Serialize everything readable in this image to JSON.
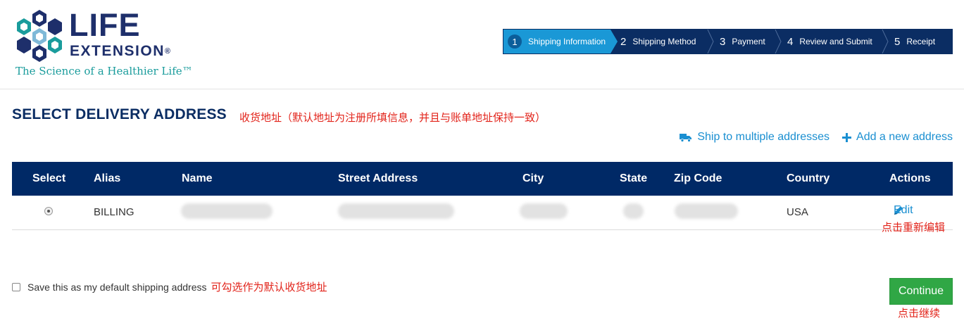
{
  "logo": {
    "line1": "LIFE",
    "line2": "EXTENSION",
    "registered": "®",
    "tagline": "The Science of a Healthier Life™"
  },
  "steps": [
    {
      "num": "1",
      "label": "Shipping Information",
      "active": true
    },
    {
      "num": "2",
      "label": "Shipping Method",
      "active": false
    },
    {
      "num": "3",
      "label": "Payment",
      "active": false
    },
    {
      "num": "4",
      "label": "Review and Submit",
      "active": false
    },
    {
      "num": "5",
      "label": "Receipt",
      "active": false
    }
  ],
  "page": {
    "title": "SELECT DELIVERY ADDRESS",
    "title_note": "收货地址（默认地址为注册所填信息，并且与账单地址保持一致）"
  },
  "links": {
    "ship_multiple": "Ship to multiple addresses",
    "add_new": "Add a new address",
    "ship_multiple_icon": "truck-icon",
    "add_new_icon": "plus-icon"
  },
  "table": {
    "headers": [
      "Select",
      "Alias",
      "Name",
      "Street Address",
      "City",
      "State",
      "Zip Code",
      "Country",
      "Actions"
    ],
    "rows": [
      {
        "alias": "BILLING",
        "country": "USA",
        "edit": "Edit",
        "edit_icon": "pencil-icon",
        "selected": true
      }
    ],
    "edit_note": "点击重新编辑"
  },
  "footer": {
    "save_label": "Save this as my default shipping address",
    "save_note": "可勾选作为默认收货地址",
    "continue_label": "Continue",
    "continue_note": "点击继续"
  },
  "colors": {
    "navy": "#002966",
    "step_active": "#1a98d6",
    "link": "#1a8fd1",
    "note_red": "#e2231a",
    "continue_green": "#30a745",
    "brand_teal": "#1a9c9c"
  }
}
